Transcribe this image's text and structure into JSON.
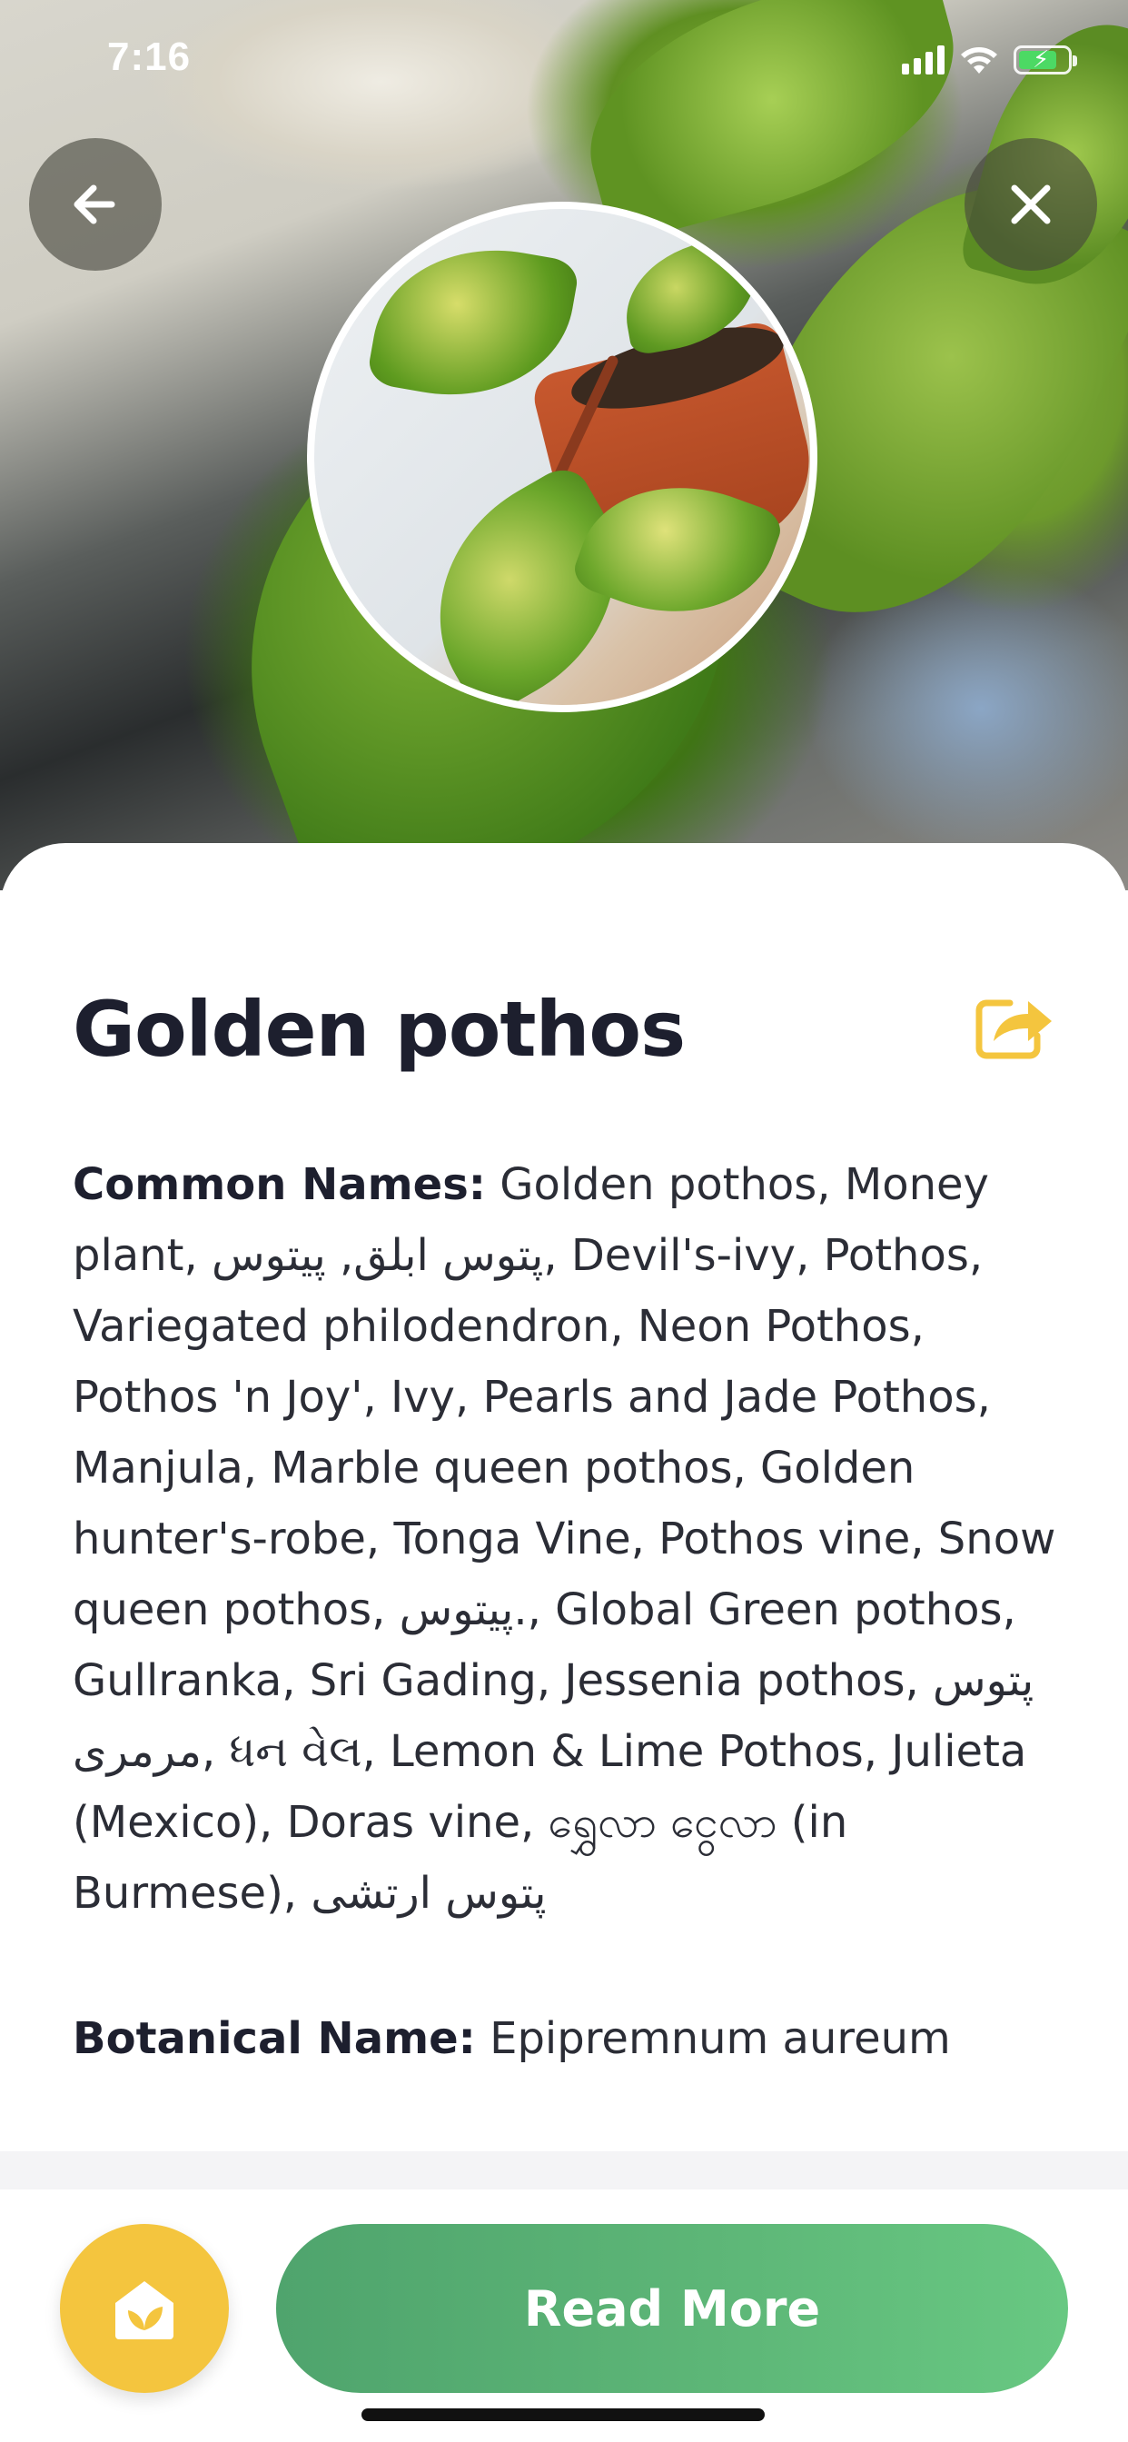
{
  "status_bar": {
    "time": "7:16",
    "icons": [
      "signal-icon",
      "wifi-icon",
      "battery-charging-icon"
    ],
    "battery_color": "#4cd964"
  },
  "nav": {
    "back_icon": "arrow-left-icon",
    "close_icon": "close-icon"
  },
  "plant": {
    "name": "Golden pothos",
    "common_names_label": "Common Names:",
    "common_names": "Golden pothos, Money plant, پتوس ابلق, پیتوس, Devil's-ivy, Pothos, Variegated philodendron, Neon Pothos, Pothos 'n Joy', Ivy, Pearls and Jade Pothos, Manjula, Marble queen pothos, Golden hunter's-robe, Tonga Vine, Pothos vine, Snow queen pothos, پیتوس., Global Green pothos, Gullranka, Sri Gading, Jessenia pothos, پتوس مرمری, ધન વેલ, Lemon & Lime Pothos, Julieta (Mexico), Doras vine, ရွှေလာ ငွေလာ (in Burmese), پتوس ارتشی",
    "botanical_name_label": "Botanical Name:",
    "botanical_name": "Epipremnum aureum"
  },
  "actions": {
    "share_icon": "share-icon",
    "home_plant_icon": "plant-house-icon",
    "read_more_label": "Read More"
  },
  "colors": {
    "title": "#1d1f2e",
    "accent_yellow": "#f4c53e",
    "accent_green": "#5db677"
  }
}
